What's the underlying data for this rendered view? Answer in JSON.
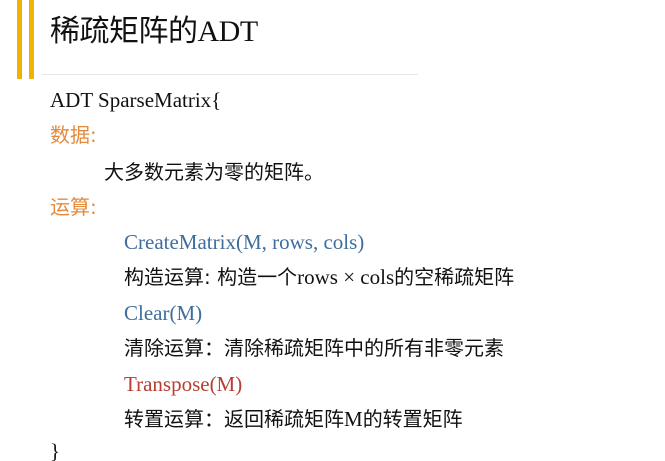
{
  "slide": {
    "title_cjk": "稀疏矩阵的",
    "title_latin": "ADT"
  },
  "adt": {
    "header": "ADT SparseMatrix{",
    "data_label": "数据:",
    "data_description": "大多数元素为零的矩阵。",
    "operations_label": "运算:",
    "operations": [
      {
        "signature": "CreateMatrix(M, rows, cols)",
        "description_parts": [
          "构造运算: 构造一个",
          "rows × cols",
          "的空稀疏矩阵"
        ]
      },
      {
        "signature": "Clear(M)",
        "description": "清除运算：清除稀疏矩阵中的所有非零元素"
      },
      {
        "signature": "Transpose(M)",
        "description_parts": [
          "转置运算：返回稀疏矩阵",
          "M",
          "的转置矩阵"
        ]
      }
    ],
    "closing": "}"
  },
  "colors": {
    "accent_bar": "#f2b200",
    "label_orange": "#e48a3c",
    "signature_blue": "#3f6e9c",
    "signature_red": "#b83d32"
  }
}
